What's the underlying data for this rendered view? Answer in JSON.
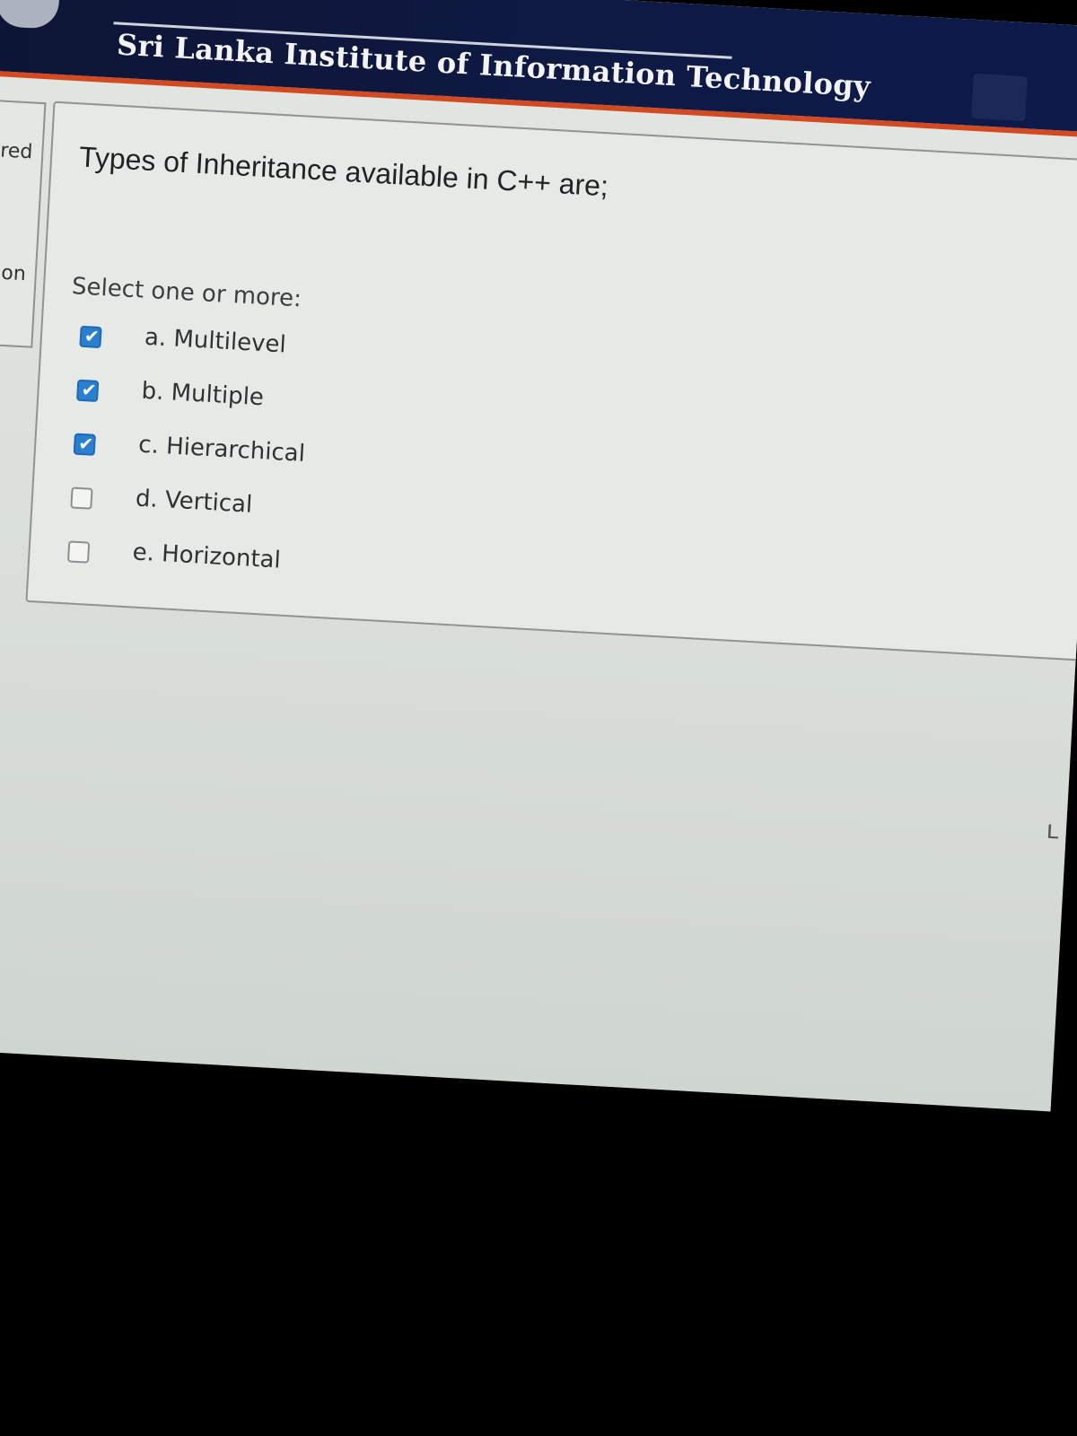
{
  "header": {
    "title": "Sri Lanka Institute of Information Technology"
  },
  "sidebar": {
    "fragment_top": "ered",
    "fragment_bottom": "ion"
  },
  "question": {
    "text": "Types of Inheritance available in C++ are;",
    "instruction": "Select one or more:",
    "options": [
      {
        "label": "a. Multilevel",
        "checked": true
      },
      {
        "label": "b. Multiple",
        "checked": true
      },
      {
        "label": "c. Hierarchical",
        "checked": true
      },
      {
        "label": "d. Vertical",
        "checked": false
      },
      {
        "label": "e. Horizontal",
        "checked": false
      }
    ]
  },
  "colors": {
    "header_bg": "#0f1a44",
    "header_accent": "#d24a22",
    "checkbox_checked": "#2a7fcf"
  }
}
